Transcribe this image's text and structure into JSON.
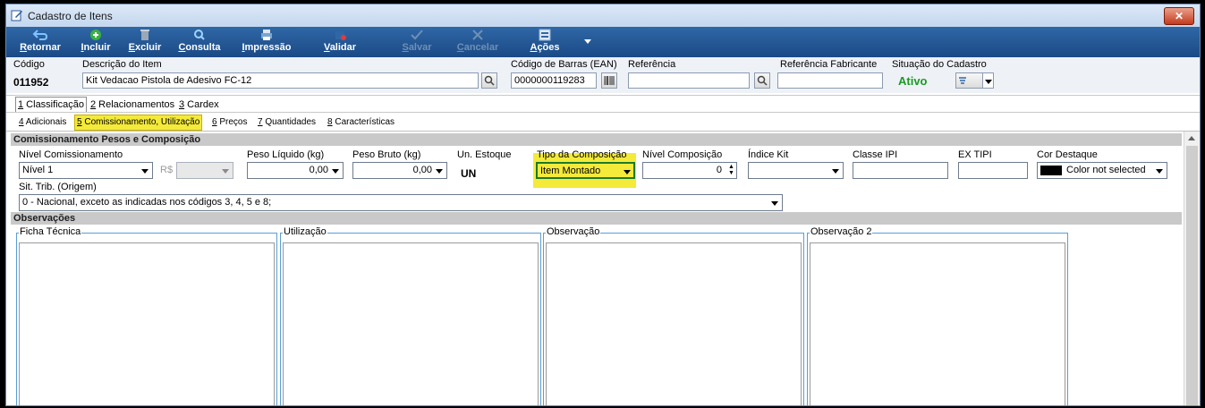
{
  "window": {
    "title": "Cadastro de Itens",
    "close_label": "✕"
  },
  "toolbar": {
    "buttons": [
      {
        "label": "Retornar",
        "icon": "return-arrow-icon",
        "enabled": true
      },
      {
        "label": "Incluir",
        "icon": "plus-circle-icon",
        "enabled": true
      },
      {
        "label": "Excluir",
        "icon": "trash-icon",
        "enabled": true
      },
      {
        "label": "Consulta",
        "icon": "magnifier-icon",
        "enabled": true
      },
      {
        "label": "Impressão",
        "icon": "printer-icon",
        "enabled": true
      },
      {
        "label": "Validar",
        "icon": "validate-icon",
        "enabled": true
      },
      {
        "label": "Salvar",
        "icon": "checkmark-icon",
        "enabled": false
      },
      {
        "label": "Cancelar",
        "icon": "cancel-x-icon",
        "enabled": false
      },
      {
        "label": "Ações",
        "icon": "actions-icon",
        "enabled": true
      }
    ]
  },
  "header": {
    "codigo_label": "Código",
    "codigo_value": "011952",
    "descricao_label": "Descrição do Item",
    "descricao_value": "Kit Vedacao Pistola de Adesivo FC-12",
    "ean_label": "Código de Barras (EAN)",
    "ean_value": "0000000119283",
    "referencia_label": "Referência",
    "referencia_value": "",
    "ref_fabricante_label": "Referência Fabricante",
    "ref_fabricante_value": "",
    "situacao_label": "Situação do Cadastro",
    "situacao_value": "Ativo"
  },
  "tabs_primary": [
    {
      "num": "1",
      "label": " Classificação",
      "active": true
    },
    {
      "num": "2",
      "label": " Relacionamentos",
      "active": false
    },
    {
      "num": "3",
      "label": " Cardex",
      "active": false
    }
  ],
  "tabs_secondary": [
    {
      "num": "4",
      "label": " Adicionais",
      "active": false
    },
    {
      "num": "5",
      "label": " Comissionamento, Utilização",
      "active": true
    },
    {
      "num": "6",
      "label": " Preços",
      "active": false
    },
    {
      "num": "7",
      "label": " Quantidades",
      "active": false
    },
    {
      "num": "8",
      "label": " Características",
      "active": false
    }
  ],
  "section_comissionamento": {
    "title": "Comissionamento Pesos e Composição",
    "nivel_label": "Nível Comissionamento",
    "nivel_value": "Nível 1",
    "rs_label": "R$",
    "peso_liquido_label": "Peso Líquido (kg)",
    "peso_liquido_value": "0,00",
    "peso_bruto_label": "Peso Bruto  (kg)",
    "peso_bruto_value": "0,00",
    "un_estoque_label": "Un. Estoque",
    "un_estoque_value": "UN",
    "tipo_composicao_label": "Tipo da Composição",
    "tipo_composicao_value": "Item Montado",
    "nivel_composicao_label": "Nível Composição",
    "nivel_composicao_value": "0",
    "indice_kit_label": "Índice Kit",
    "indice_kit_value": "",
    "classe_ipi_label": "Classe IPI",
    "classe_ipi_value": "",
    "ex_tipi_label": "EX TIPI",
    "ex_tipi_value": "",
    "cor_destaque_label": "Cor Destaque",
    "cor_destaque_value": "Color not selected",
    "sit_trib_label": "Sit. Trib. (Origem)",
    "sit_trib_value": "0 - Nacional, exceto as indicadas nos códigos 3, 4, 5 e 8;"
  },
  "section_observacoes": {
    "title": "Observações",
    "boxes": [
      "Ficha Técnica",
      "Utilização",
      "Observação",
      "Observação 2"
    ]
  },
  "colors": {
    "toolbar_bg": "#1b4a86",
    "highlight": "#f4ea3a",
    "status_active": "#1a9a22"
  }
}
